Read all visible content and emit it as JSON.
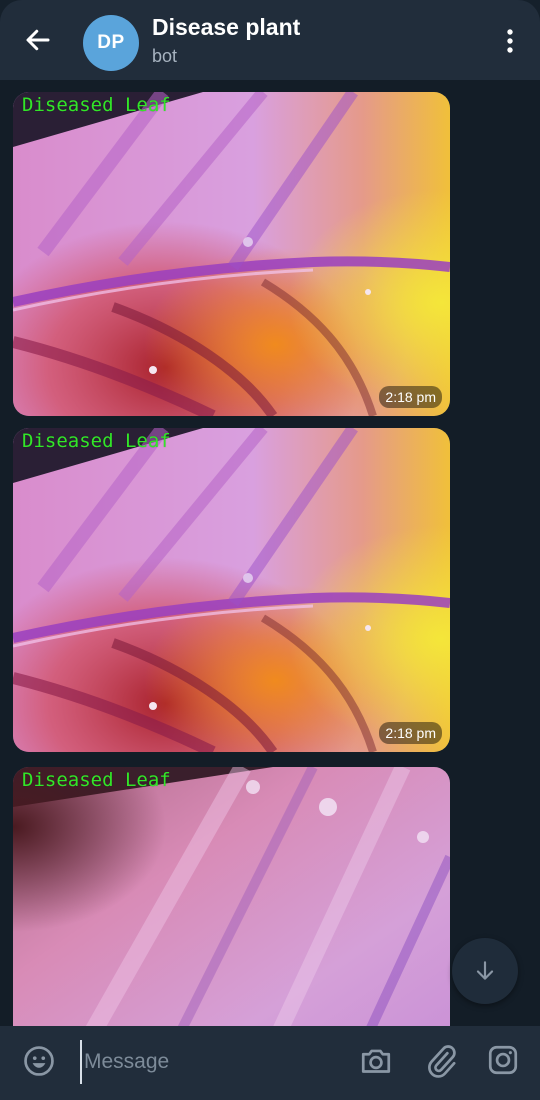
{
  "header": {
    "back_icon": "arrow-left-icon",
    "avatar_initials": "DP",
    "avatar_color": "#5aa4db",
    "title": "Disease plant",
    "subtitle": "bot",
    "menu_icon": "more-vertical-icon"
  },
  "messages": [
    {
      "label": "Diseased Leaf",
      "time": "2:18 pm"
    },
    {
      "label": "Diseased Leaf",
      "time": "2:18 pm"
    },
    {
      "label": "Diseased Leaf",
      "time": ""
    }
  ],
  "scroll_button": {
    "icon": "arrow-down-icon"
  },
  "input_bar": {
    "emoji_icon": "emoji-icon",
    "placeholder": "Message",
    "camera_icon": "camera-icon",
    "attach_icon": "paperclip-icon",
    "instagram_icon": "instagram-icon"
  },
  "colors": {
    "header_bg": "#212d3b",
    "chat_bg": "#131d27",
    "label_green": "#32e628"
  }
}
